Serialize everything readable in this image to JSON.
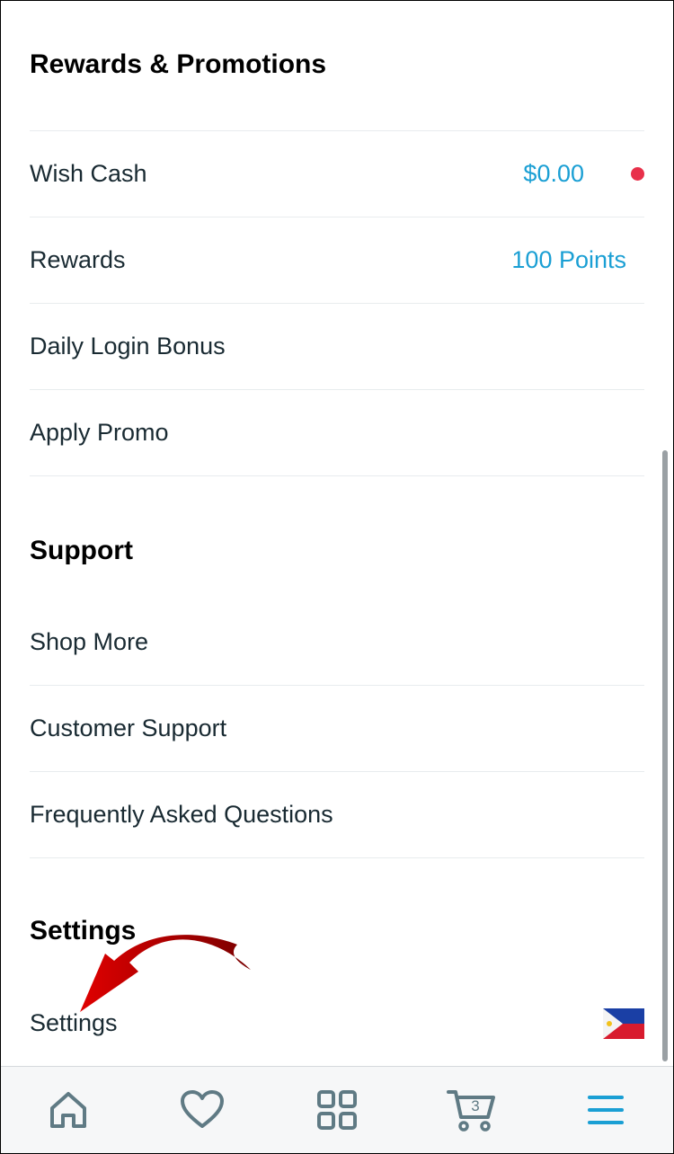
{
  "sections": {
    "rewards_title": "Rewards & Promotions",
    "support_title": "Support",
    "settings_title": "Settings"
  },
  "rewards": {
    "wish_cash": {
      "label": "Wish Cash",
      "value": "$0.00"
    },
    "rewards": {
      "label": "Rewards",
      "value": "100 Points"
    },
    "daily_login": {
      "label": "Daily Login Bonus"
    },
    "apply_promo": {
      "label": "Apply Promo"
    }
  },
  "support": {
    "shop_more": "Shop More",
    "customer_support": "Customer Support",
    "faq": "Frequently Asked Questions"
  },
  "settings": {
    "settings_label": "Settings",
    "flag_icon": "philippines-flag-icon"
  },
  "bottom_nav": {
    "items": [
      "home-icon",
      "heart-icon",
      "grid-icon",
      "cart-icon",
      "menu-icon"
    ],
    "cart_count": "3"
  },
  "colors": {
    "accent": "#1a9fd4",
    "notification_dot": "#e8304a",
    "nav_icon": "#5f7a84",
    "active_nav": "#1a9fd4",
    "annotation_arrow": "#c00000"
  }
}
